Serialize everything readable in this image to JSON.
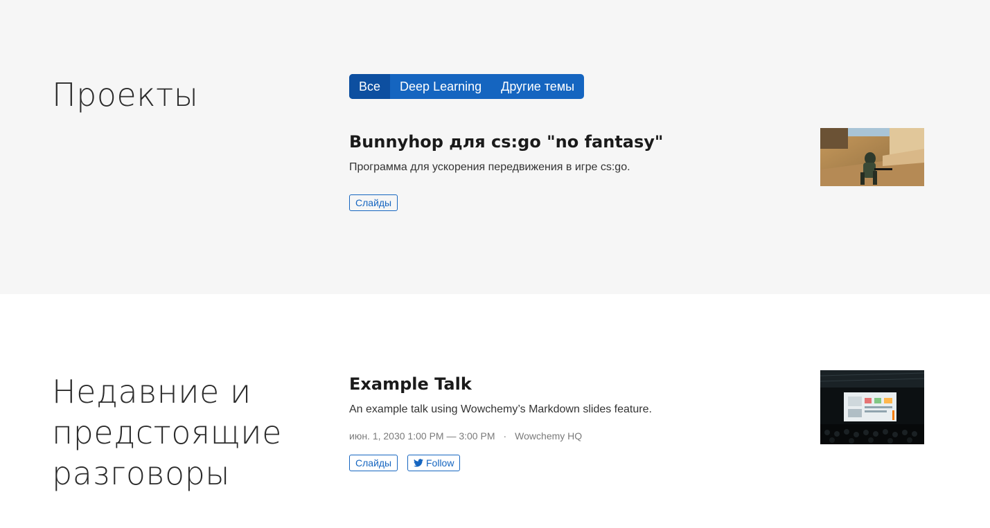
{
  "projects": {
    "title": "Проекты",
    "filters": [
      {
        "label": "Все",
        "active": true
      },
      {
        "label": "Deep Learning",
        "active": false
      },
      {
        "label": "Другие темы",
        "active": false
      }
    ],
    "item": {
      "title": "Bunnyhop для cs:go \"no fantasy\"",
      "summary": "Программа для ускорения передвижения в игре cs:go.",
      "button": "Слайды",
      "thumbnail_icon": "game-screenshot-image"
    }
  },
  "talks": {
    "title": "Недавние и предстоящие разговоры",
    "item": {
      "title": "Example Talk",
      "summary": "An example talk using Wowchemy’s Markdown slides feature.",
      "date": "июн. 1, 2030 1:00 PM — 3:00 PM",
      "separator": "·",
      "location": "Wowchemy HQ",
      "slides_button": "Слайды",
      "follow_button": "Follow",
      "follow_icon": "twitter-icon",
      "thumbnail_icon": "conference-talk-image"
    }
  },
  "colors": {
    "accent": "#1565c0",
    "accent_active": "#0d4fa0",
    "alt_section_bg": "#f6f6f6"
  }
}
